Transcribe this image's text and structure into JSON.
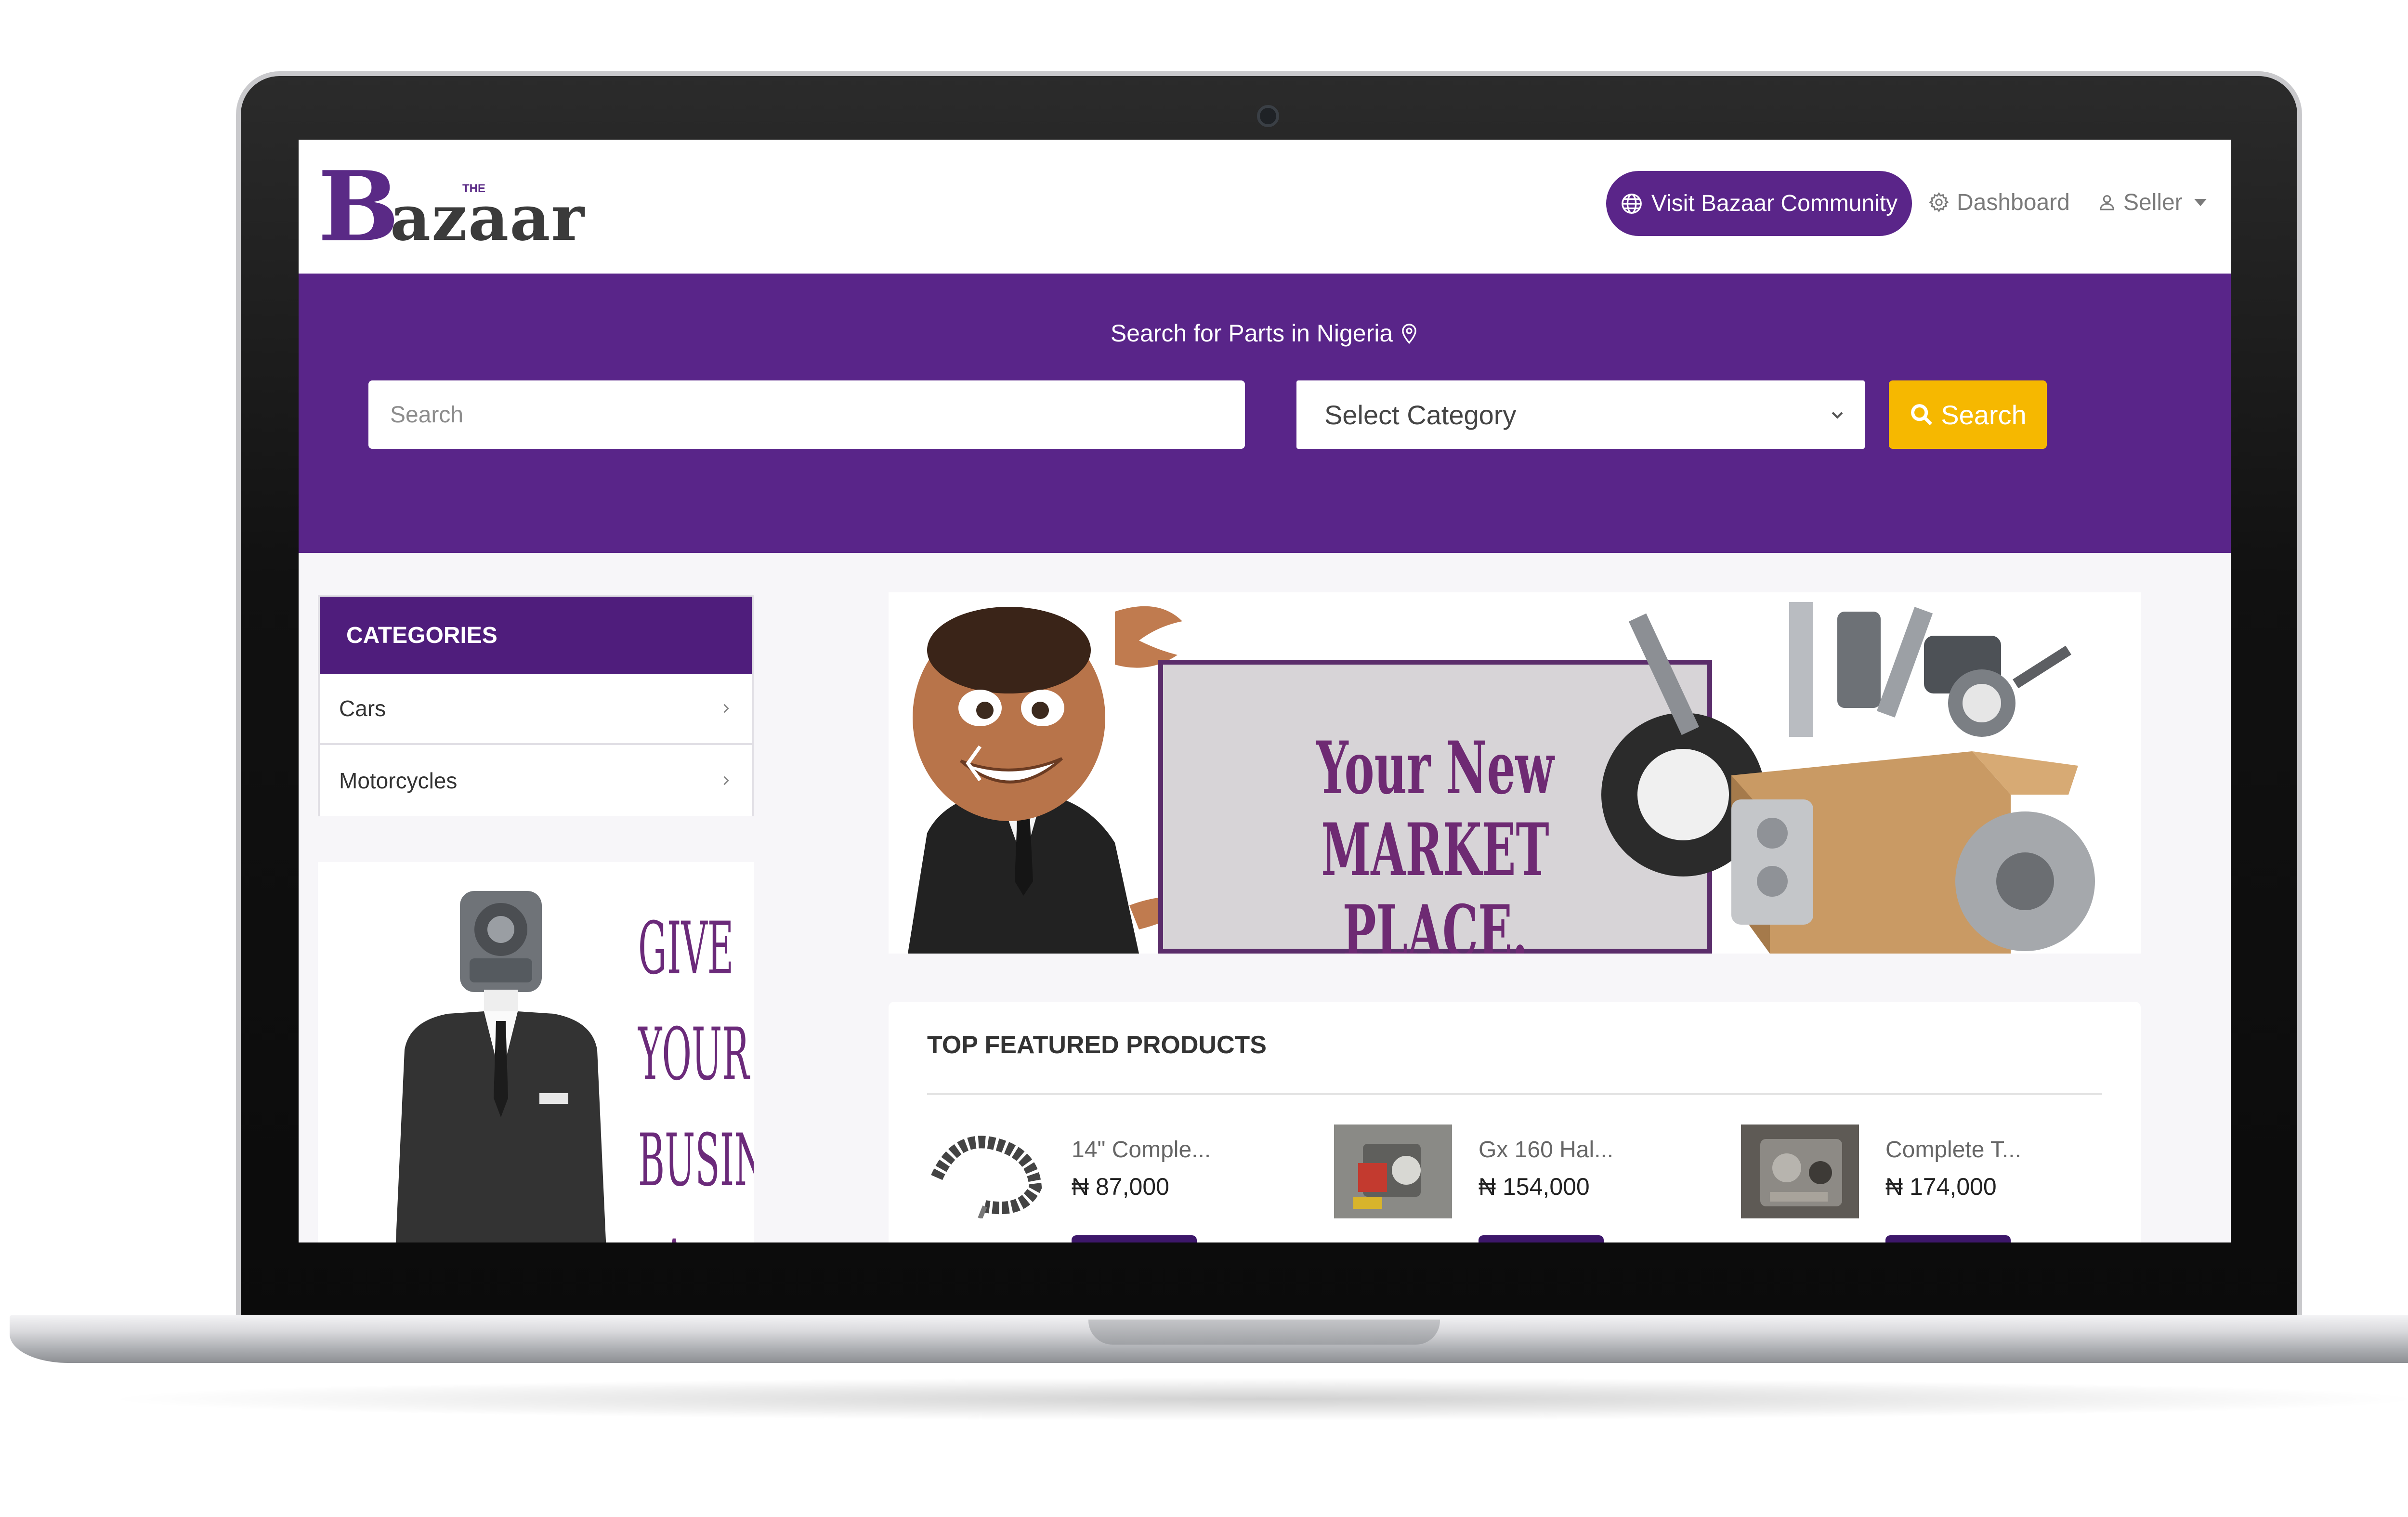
{
  "brand": {
    "logo_letter": "B",
    "logo_rest": "azaar",
    "logo_small": "THE",
    "color_primary": "#592589",
    "color_accent": "#f6b800"
  },
  "nav": {
    "community_label": "Visit Bazaar Community",
    "community_icon": "globe-icon",
    "dashboard_label": "Dashboard",
    "dashboard_icon": "gear-icon",
    "seller_label": "Seller",
    "seller_icon": "user-icon"
  },
  "search": {
    "title": "Search for Parts in Nigeria",
    "placeholder": "Search",
    "category_selected": "Select Category",
    "button_label": "Search"
  },
  "categories": {
    "heading": "CATEGORIES",
    "items": [
      {
        "label": "Cars"
      },
      {
        "label": "Motorcycles"
      }
    ]
  },
  "side_banner": {
    "lines": [
      "GIVE",
      "YOUR",
      "BUSINESS",
      "A FACE"
    ]
  },
  "main_banner": {
    "line1": "Your New",
    "line2": "MARKET PLACE."
  },
  "featured": {
    "title": "TOP FEATURED PRODUCTS",
    "products": [
      {
        "name": "14\" Comple...",
        "price": "₦ 87,000"
      },
      {
        "name": "Gx 160 Hal...",
        "price": "₦ 154,000"
      },
      {
        "name": "Complete T...",
        "price": "₦ 174,000"
      }
    ]
  }
}
